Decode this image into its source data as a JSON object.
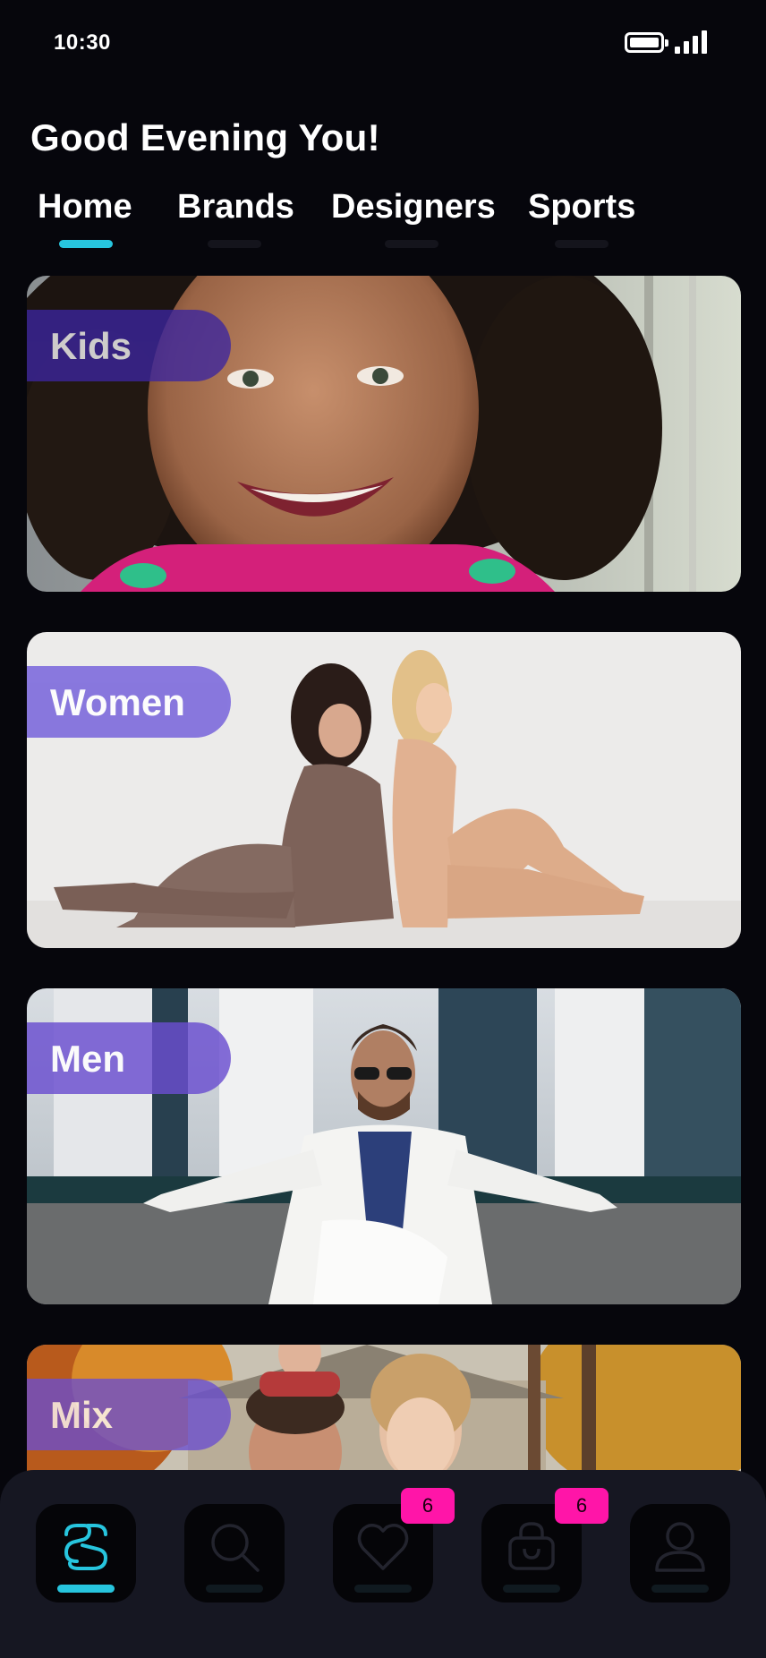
{
  "status": {
    "time": "10:30",
    "battery_level": 1.0
  },
  "greeting": "Good Evening You!",
  "tabs": [
    {
      "label": "Home",
      "active": true
    },
    {
      "label": "Brands",
      "active": false
    },
    {
      "label": "Designers",
      "active": false
    },
    {
      "label": "Sports",
      "active": false
    }
  ],
  "categories": [
    {
      "label": "Kids"
    },
    {
      "label": "Women"
    },
    {
      "label": "Men"
    },
    {
      "label": "Mix"
    }
  ],
  "nav": {
    "items": [
      {
        "icon": "logo-icon",
        "active": true
      },
      {
        "icon": "search-icon",
        "active": false
      },
      {
        "icon": "heart-icon",
        "active": false,
        "badge": "6"
      },
      {
        "icon": "bag-icon",
        "active": false,
        "badge": "6"
      },
      {
        "icon": "profile-icon",
        "active": false
      }
    ]
  },
  "colors": {
    "background": "#06060c",
    "accent": "#27c5de",
    "badge": "#ff15a8",
    "category_badge": "#7b68dc",
    "nav_bar": "#161722"
  }
}
